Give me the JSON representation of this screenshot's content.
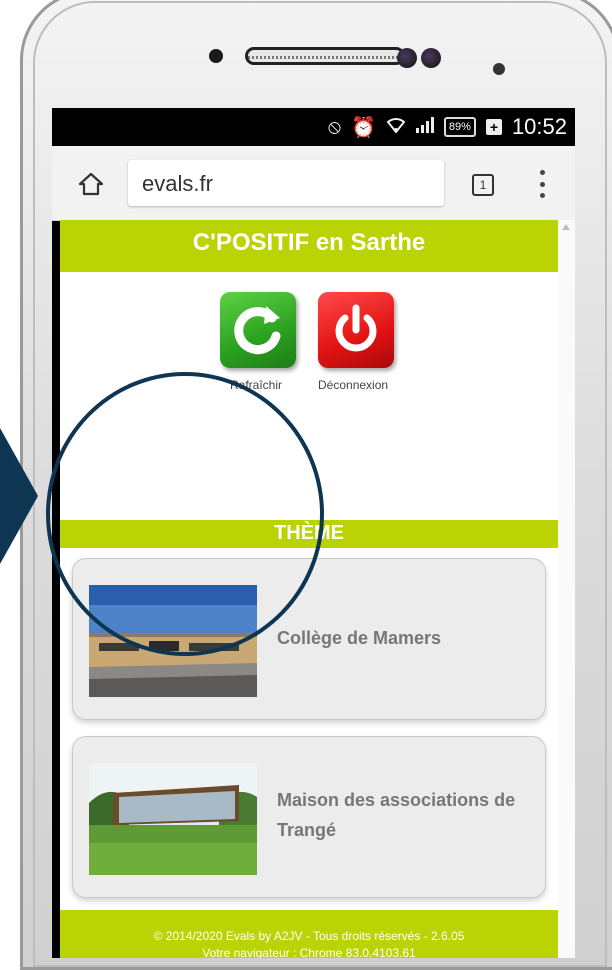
{
  "status_bar": {
    "battery": "89%",
    "time": "10:52"
  },
  "browser": {
    "url": "evals.fr",
    "tab_count": "1"
  },
  "header": {
    "title": "C'POSITIF en Sarthe"
  },
  "actions": {
    "refresh_label": "Rafraîchir",
    "logout_label": "Déconnexion"
  },
  "theme_label": "THÈME",
  "cards": [
    {
      "title_lines": [
        "Collège de Mamers"
      ]
    },
    {
      "title_lines": [
        "Maison des associations de",
        "Trangé"
      ]
    }
  ],
  "footer": {
    "line1": "© 2014/2020 Evals by A2JV - Tous droits réservés - 2.6.05",
    "line2": "Votre navigateur : Chrome 83.0.4103.61"
  },
  "colors": {
    "accent": "#b9d305",
    "highlight": "#0e3552",
    "refresh_green": "#2aa020",
    "logout_red": "#e21212"
  }
}
